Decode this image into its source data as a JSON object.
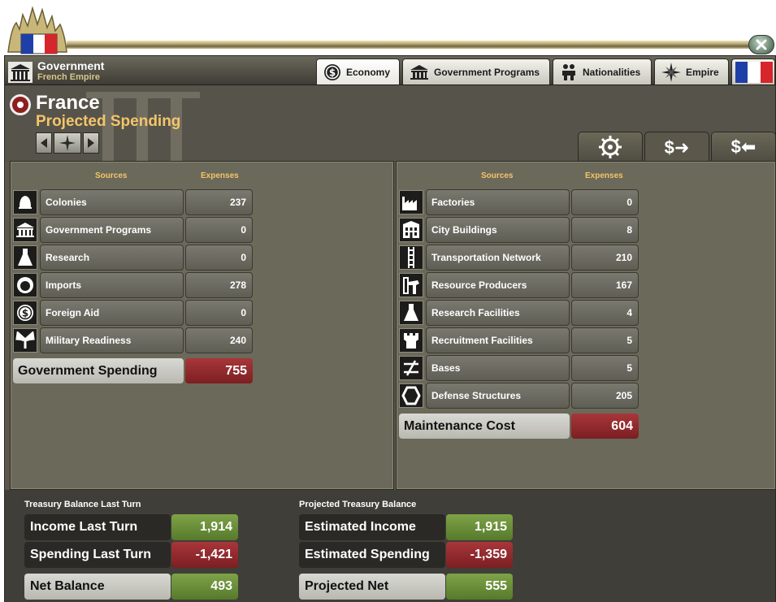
{
  "window": {
    "title": "Government",
    "subtitle": "French Empire"
  },
  "tabs": [
    {
      "label": "Economy",
      "icon": "dollar-coin-icon",
      "selected": true
    },
    {
      "label": "Government Programs",
      "icon": "government-building-icon",
      "selected": false
    },
    {
      "label": "Nationalities",
      "icon": "people-icon",
      "selected": false
    },
    {
      "label": "Empire",
      "icon": "compass-star-icon",
      "selected": false
    },
    {
      "label": "",
      "icon": "france-flag-icon",
      "selected": false
    }
  ],
  "header": {
    "nation": "France",
    "screen_title": "Projected Spending"
  },
  "subtabs": [
    {
      "label": "",
      "icon": "gear-icon"
    },
    {
      "label": "$➜",
      "icon": "expenses-icon",
      "selected": true
    },
    {
      "label": "$⬅",
      "icon": "income-icon"
    }
  ],
  "left_panel": {
    "col_sources": "Sources",
    "col_expenses": "Expenses",
    "rows": [
      {
        "label": "Colonies",
        "value": "237",
        "icon": "bell-icon"
      },
      {
        "label": "Government Programs",
        "value": "0",
        "icon": "government-building-icon"
      },
      {
        "label": "Research",
        "value": "0",
        "icon": "flask-icon"
      },
      {
        "label": "Imports",
        "value": "278",
        "icon": "fist-icon"
      },
      {
        "label": "Foreign Aid",
        "value": "0",
        "icon": "dollar-coin-icon"
      },
      {
        "label": "Military Readiness",
        "value": "240",
        "icon": "military-readiness-icon"
      }
    ],
    "total_label": "Government Spending",
    "total_value": "755"
  },
  "right_panel": {
    "col_sources": "Sources",
    "col_expenses": "Expenses",
    "rows": [
      {
        "label": "Factories",
        "value": "0",
        "icon": "factory-icon"
      },
      {
        "label": "City Buildings",
        "value": "8",
        "icon": "city-building-icon"
      },
      {
        "label": "Transportation Network",
        "value": "210",
        "icon": "rail-track-icon"
      },
      {
        "label": "Resource Producers",
        "value": "167",
        "icon": "oil-derrick-icon"
      },
      {
        "label": "Research Facilities",
        "value": "4",
        "icon": "flask-icon"
      },
      {
        "label": "Recruitment Facilities",
        "value": "5",
        "icon": "fortress-icon"
      },
      {
        "label": "Bases",
        "value": "5",
        "icon": "base-icon"
      },
      {
        "label": "Defense Structures",
        "value": "205",
        "icon": "hexagon-icon"
      }
    ],
    "total_label": "Maintenance Cost",
    "total_value": "604"
  },
  "treasury": {
    "last_turn_heading": "Treasury Balance Last Turn",
    "projected_heading": "Projected Treasury Balance",
    "income_last_turn_label": "Income Last Turn",
    "income_last_turn_value": "1,914",
    "spending_last_turn_label": "Spending Last Turn",
    "spending_last_turn_value": "-1,421",
    "net_balance_label": "Net Balance",
    "net_balance_value": "493",
    "estimated_income_label": "Estimated Income",
    "estimated_income_value": "1,915",
    "estimated_spending_label": "Estimated Spending",
    "estimated_spending_value": "-1,359",
    "projected_net_label": "Projected Net",
    "projected_net_value": "555"
  },
  "colors": {
    "gold": "#f3c56a",
    "positive_green": "#6a8f3a",
    "negative_red": "#8e2a2d",
    "panel": "#6b6959"
  }
}
